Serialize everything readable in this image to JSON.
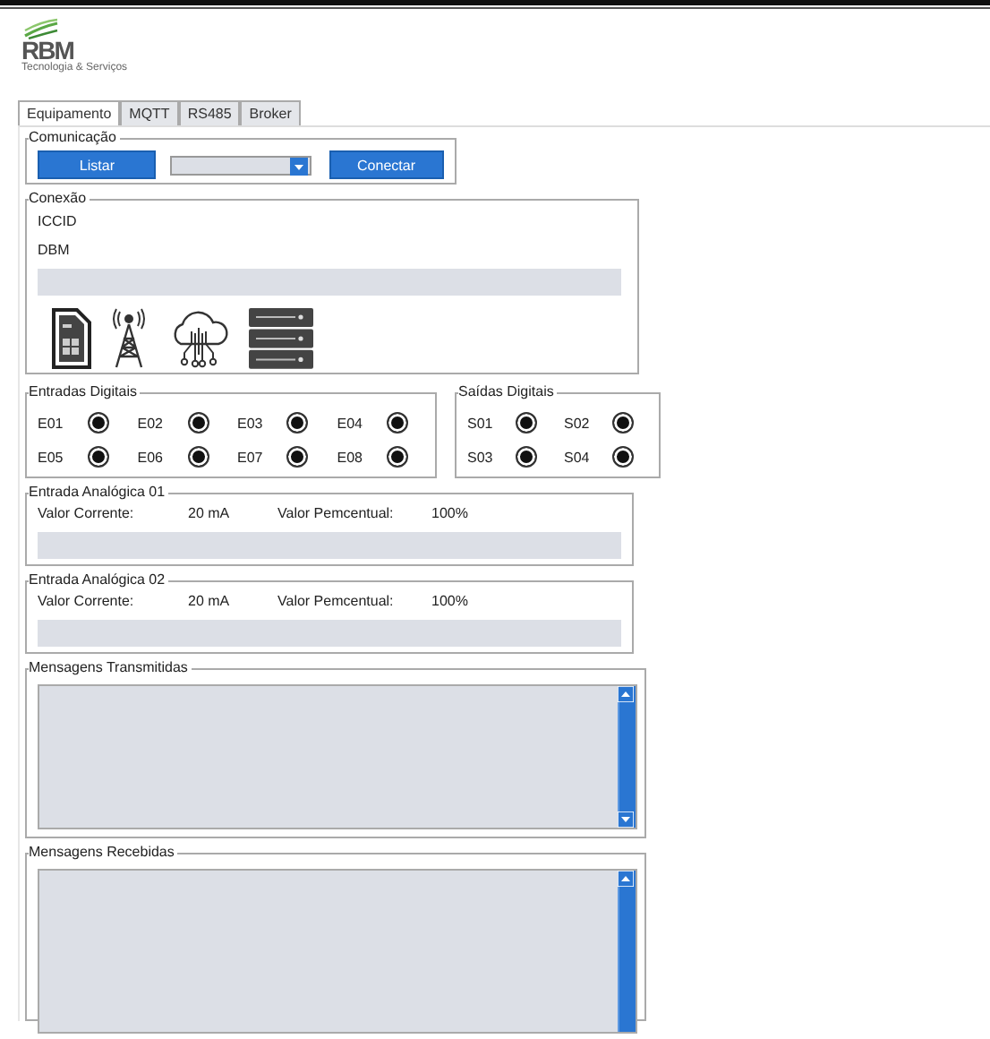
{
  "logo": {
    "text": "RBM",
    "tagline": "Tecnologia & Serviços"
  },
  "tabs": [
    {
      "label": "Equipamento",
      "selected": true
    },
    {
      "label": "MQTT",
      "selected": false
    },
    {
      "label": "RS485",
      "selected": false
    },
    {
      "label": "Broker",
      "selected": false
    }
  ],
  "comunicacao": {
    "title": "Comunicação",
    "list_button": "Listar",
    "connect_button": "Conectar"
  },
  "conexao": {
    "title": "Conexão",
    "lines": [
      "ICCID",
      "DBM"
    ]
  },
  "digital_inputs": {
    "title": "Entradas Digitais",
    "items": [
      {
        "label": "E01",
        "on": true
      },
      {
        "label": "E02",
        "on": true
      },
      {
        "label": "E03",
        "on": true
      },
      {
        "label": "E04",
        "on": true
      },
      {
        "label": "E05",
        "on": true
      },
      {
        "label": "E06",
        "on": true
      },
      {
        "label": "E07",
        "on": true
      },
      {
        "label": "E08",
        "on": true
      }
    ]
  },
  "digital_outputs": {
    "title": "Saídas Digitais",
    "items": [
      {
        "label": "S01",
        "on": true
      },
      {
        "label": "S02",
        "on": true
      },
      {
        "label": "S03",
        "on": true
      },
      {
        "label": "S04",
        "on": true
      }
    ]
  },
  "analog_inputs": [
    {
      "title": "Entrada Analógica 01",
      "current_label": "Valor Corrente:",
      "current": "20 mA",
      "percent_label": "Valor Pemcentual:",
      "percent": "100%"
    },
    {
      "title": "Entrada Analógica 02",
      "current_label": "Valor Corrente:",
      "current": "20 mA",
      "percent_label": "Valor Pemcentual:",
      "percent": "100%"
    }
  ],
  "messages": [
    {
      "title": "Mensagens Transmitidas"
    },
    {
      "title": "Mensagens Recebidas"
    }
  ]
}
